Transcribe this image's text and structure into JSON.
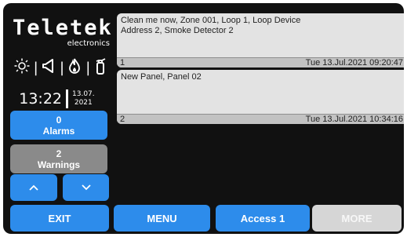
{
  "logo": {
    "brand": "Teletek",
    "sub": "electronics"
  },
  "status_icons": [
    "sun-icon",
    "speaker-icon",
    "flame-icon",
    "extinguisher-icon"
  ],
  "clock": {
    "time": "13:22",
    "date_day_month": "13.07.",
    "date_year": "2021"
  },
  "counters": {
    "alarms": {
      "count": "0",
      "label": "Alarms"
    },
    "warnings": {
      "count": "2",
      "label": "Warnings"
    }
  },
  "events": [
    {
      "text_line1": "Clean me now, Zone 001, Loop 1, Loop Device",
      "text_line2": "Address 2, Smoke Detector 2",
      "index": "1",
      "timestamp": "Tue 13.Jul.2021 09:20:47"
    },
    {
      "text_line1": "New Panel, Panel 02",
      "text_line2": "",
      "index": "2",
      "timestamp": "Tue 13.Jul.2021 10:34:16"
    }
  ],
  "buttons": {
    "exit": "EXIT",
    "menu": "MENU",
    "access": "Access 1",
    "more": "MORE"
  },
  "colors": {
    "background": "#111111",
    "button_blue": "#2d8ceb",
    "button_gray": "#8a8a8a",
    "button_disabled": "#d6d6d6",
    "event_bg": "#e3e3e3"
  }
}
